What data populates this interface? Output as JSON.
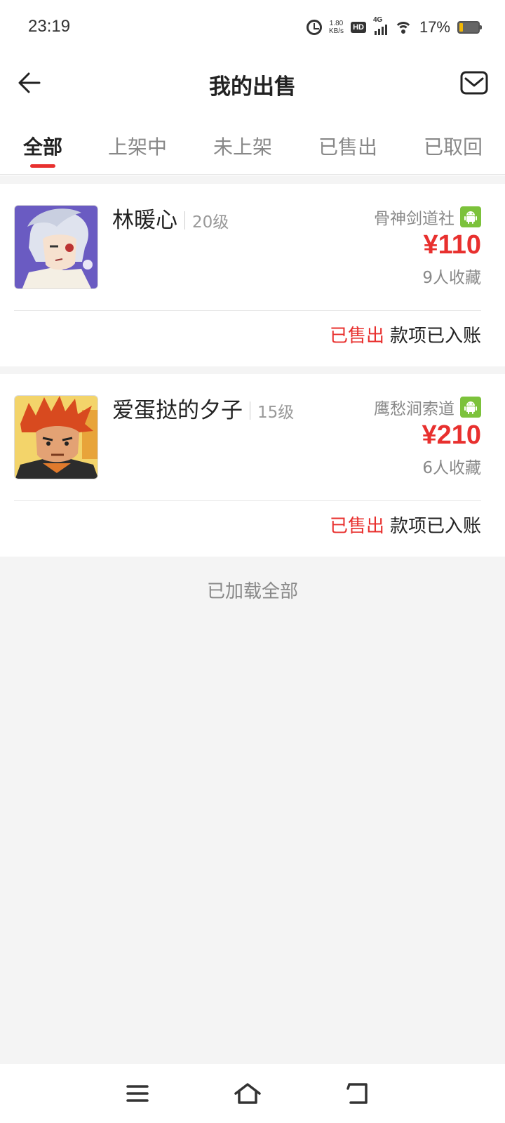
{
  "status_bar": {
    "time": "23:19",
    "network_speed_value": "1.80",
    "network_speed_unit": "KB/s",
    "hd_label": "HD",
    "signal_label": "4G",
    "battery_percent": "17%",
    "battery_level": 0.17,
    "icons": [
      "alarm-icon",
      "hd-icon",
      "signal-icon",
      "wifi-icon",
      "battery-icon"
    ]
  },
  "header": {
    "title": "我的出售",
    "back_icon": "arrow-left-icon",
    "mail_icon": "mail-icon"
  },
  "tabs": [
    {
      "label": "全部",
      "active": true
    },
    {
      "label": "上架中",
      "active": false
    },
    {
      "label": "未上架",
      "active": false
    },
    {
      "label": "已售出",
      "active": false
    },
    {
      "label": "已取回",
      "active": false
    }
  ],
  "listings": [
    {
      "name": "林暖心",
      "level": "20级",
      "server": "骨神剑道社",
      "platform_icon": "android-icon",
      "price": "¥110",
      "favorites": "9人收藏",
      "status": "已售出",
      "status_note": "款项已入账"
    },
    {
      "name": "爱蛋挞的夕子",
      "level": "15级",
      "server": "鹰愁涧索道",
      "platform_icon": "android-icon",
      "price": "¥210",
      "favorites": "6人收藏",
      "status": "已售出",
      "status_note": "款项已入账"
    }
  ],
  "footer_text": "已加载全部",
  "system_nav": [
    "menu-icon",
    "home-icon",
    "back-icon"
  ],
  "colors": {
    "accent": "#e8302e",
    "android_badge": "#7cc23b",
    "background": "#f4f4f4"
  }
}
